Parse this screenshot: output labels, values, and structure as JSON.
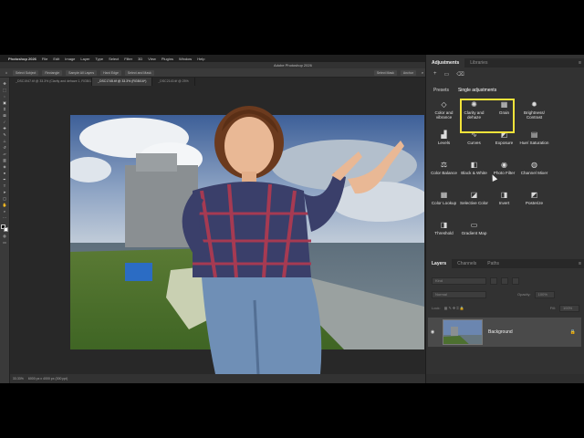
{
  "menubar": {
    "apple": "",
    "app": "Photoshop 2026",
    "items": [
      "File",
      "Edit",
      "Image",
      "Layer",
      "Type",
      "Select",
      "Filter",
      "3D",
      "View",
      "Plugins",
      "Window",
      "Help"
    ]
  },
  "window": {
    "title": "Adobe Photoshop 2026"
  },
  "options": {
    "items": [
      "Select Subject",
      "Rectangle",
      "Sample All Layers",
      "Hard Edge",
      "Select and Mask"
    ],
    "right": [
      "Select Mask",
      "Anchor"
    ]
  },
  "doc_tabs": [
    {
      "label": "_DSC1947.tif @ 33.3% (Clarity and dehaze 1, RGB/16*)",
      "active": false
    },
    {
      "label": "_DSC1745.tif @ 33.3% (RGB/16*)",
      "active": true
    },
    {
      "label": "_DSC2143.tif @ 25%",
      "active": false
    }
  ],
  "status": {
    "zoom": "33.33%",
    "size": "6000 px x 4000 px (300 ppi)"
  },
  "adjustments": {
    "tabs": [
      "Adjustments",
      "Libraries"
    ],
    "section_presets": "Presets",
    "section_single": "Single adjustments",
    "items": [
      {
        "icon": "◇",
        "icon_name": "color-vibrance-icon",
        "label": "Color and vibrance"
      },
      {
        "icon": "✺",
        "icon_name": "clarity-dehaze-icon",
        "label": "Clarity and dehaze"
      },
      {
        "icon": "▦",
        "icon_name": "grain-icon",
        "label": "Grain"
      },
      {
        "icon": "✹",
        "icon_name": "brightness-contrast-icon",
        "label": "Brightness/ Contrast"
      },
      {
        "icon": "▟",
        "icon_name": "levels-icon",
        "label": "Levels"
      },
      {
        "icon": "∿",
        "icon_name": "curves-icon",
        "label": "Curves"
      },
      {
        "icon": "◩",
        "icon_name": "exposure-icon",
        "label": "Exposure"
      },
      {
        "icon": "▤",
        "icon_name": "hue-saturation-icon",
        "label": "Hue/ Saturation"
      },
      {
        "icon": "⚖",
        "icon_name": "color-balance-icon",
        "label": "Color Balance"
      },
      {
        "icon": "◧",
        "icon_name": "black-white-icon",
        "label": "Black & White"
      },
      {
        "icon": "◉",
        "icon_name": "photo-filter-icon",
        "label": "Photo Filter"
      },
      {
        "icon": "◍",
        "icon_name": "channel-mixer-icon",
        "label": "Channel Mixer"
      },
      {
        "icon": "▦",
        "icon_name": "color-lookup-icon",
        "label": "Color Lookup"
      },
      {
        "icon": "◪",
        "icon_name": "selective-color-icon",
        "label": "Selective Color"
      },
      {
        "icon": "◨",
        "icon_name": "invert-icon",
        "label": "Invert"
      },
      {
        "icon": "◩",
        "icon_name": "posterize-icon",
        "label": "Posterize"
      },
      {
        "icon": "◨",
        "icon_name": "threshold-icon",
        "label": "Threshold"
      },
      {
        "icon": "▭",
        "icon_name": "gradient-map-icon",
        "label": "Gradient Map"
      }
    ]
  },
  "layers": {
    "tabs": [
      "Layers",
      "Channels",
      "Paths"
    ],
    "kind_placeholder": "Kind",
    "blend_mode": "Normal",
    "opacity_label": "Opacity:",
    "opacity_value": "100%",
    "lock_label": "Lock:",
    "fill_label": "Fill:",
    "fill_value": "100%",
    "layer_name": "Background"
  },
  "colors": {
    "highlight": "#f2e33a",
    "panel_bg": "#323232",
    "canvas_bg": "#282828"
  }
}
